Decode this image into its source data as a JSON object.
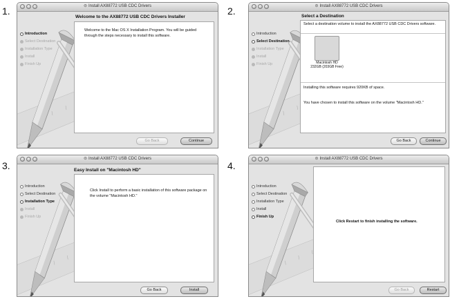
{
  "window_title": "Install AX88772 USB CDC Drivers",
  "sidebar_labels": [
    "Introduction",
    "Select Destination",
    "Installation Type",
    "Install",
    "Finish Up"
  ],
  "panels": [
    {
      "number": "1.",
      "heading": "Welcome to the AX88772 USB CDC Drivers Installer",
      "body": "Welcome to the Mac OS X Installation Program. You will be guided through the steps necessary to install this software.",
      "back_label": "Go Back",
      "primary_label": "Continue"
    },
    {
      "number": "2.",
      "heading": "Select a Destination",
      "body": "Select a destination volume to install the AX88772 USB CDC Drivers software.",
      "volume_name": "Macintosh HD",
      "volume_size": "232GB (203GB Free)",
      "space_text": "Installing this software requires 920KB of space.",
      "chosen_text": "You have chosen to install this software on the volume \"Macintosh HD.\"",
      "back_label": "Go Back",
      "primary_label": "Continue"
    },
    {
      "number": "3.",
      "heading": "Easy Install on \"Macintosh HD\"",
      "body": "Click Install to perform a basic installation of this software package on the volume \"Macintosh HD.\"",
      "back_label": "Go Back",
      "primary_label": "Install"
    },
    {
      "number": "4.",
      "heading": "",
      "body": "Click Restart to finish installing the software.",
      "back_label": "Go Back",
      "primary_label": "Restart"
    }
  ]
}
